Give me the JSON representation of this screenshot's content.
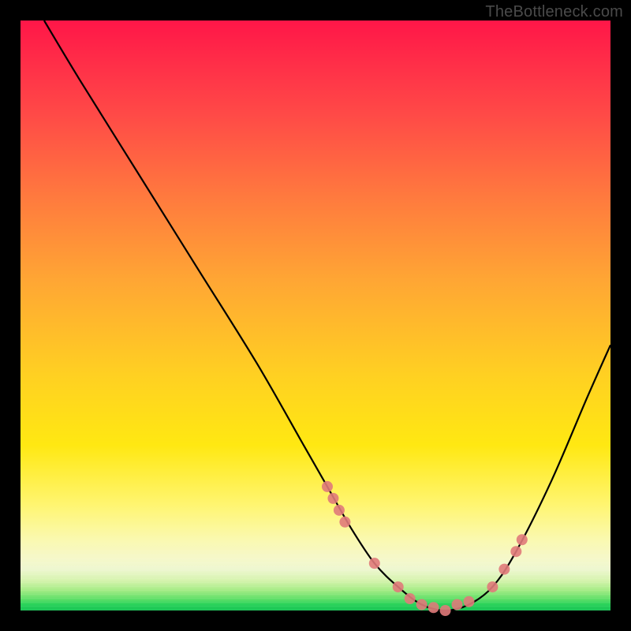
{
  "watermark": "TheBottleneck.com",
  "chart_data": {
    "type": "line",
    "title": "",
    "xlabel": "",
    "ylabel": "",
    "xlim": [
      0,
      100
    ],
    "ylim": [
      0,
      100
    ],
    "series": [
      {
        "name": "bottleneck-curve",
        "x": [
          4,
          10,
          20,
          30,
          40,
          48,
          52,
          56,
          60,
          64,
          68,
          72,
          76,
          80,
          84,
          90,
          96,
          100
        ],
        "y": [
          100,
          90,
          74,
          58,
          42,
          28,
          21,
          14,
          8,
          4,
          1,
          0,
          1,
          4,
          10,
          22,
          36,
          45
        ]
      }
    ],
    "markers": {
      "name": "highlight-points",
      "color": "#e07a7a",
      "x": [
        52,
        53,
        54,
        55,
        60,
        64,
        66,
        68,
        70,
        72,
        74,
        76,
        80,
        82,
        84,
        85
      ],
      "y": [
        21,
        19,
        17,
        15,
        8,
        4,
        2,
        1,
        0.5,
        0,
        1,
        1.5,
        4,
        7,
        10,
        12
      ]
    }
  }
}
